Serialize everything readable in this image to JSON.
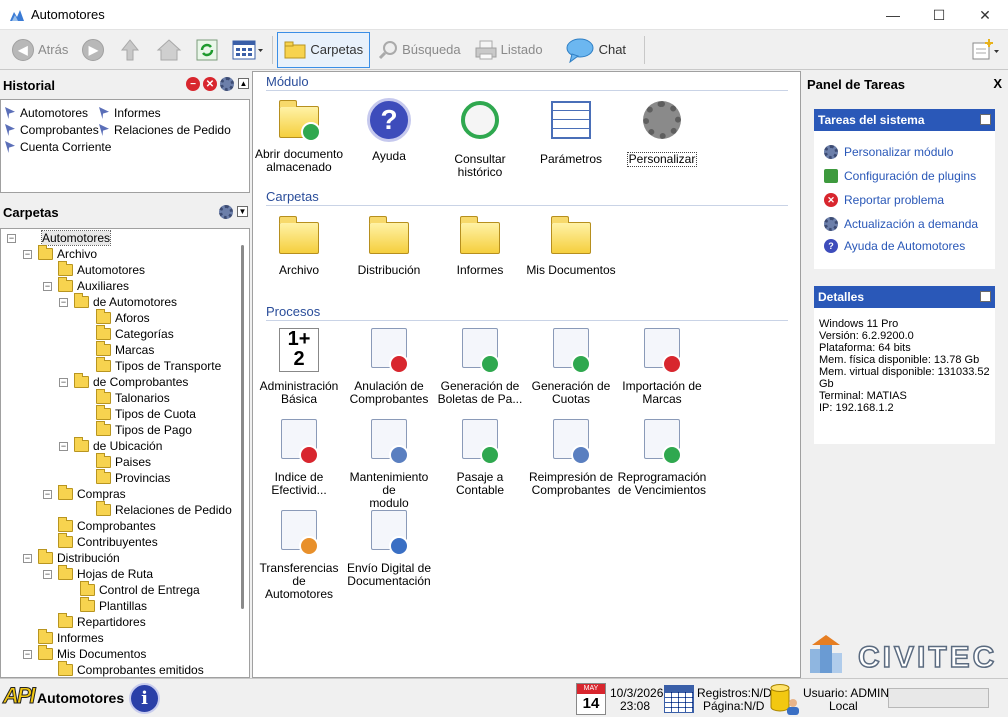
{
  "window": {
    "title": "Automotores",
    "minimize": "—",
    "maximize": "☐",
    "close": "✕"
  },
  "toolbar": {
    "back": "Atrás",
    "folders": "Carpetas",
    "search": "Búsqueda",
    "listing": "Listado",
    "chat": "Chat"
  },
  "history": {
    "title": "Historial",
    "items": [
      "Automotores",
      "Informes",
      "Comprobantes",
      "Relaciones de Pedido",
      "Cuenta Corriente"
    ]
  },
  "folders_tree": {
    "title": "Carpetas",
    "rows": [
      {
        "label": "Automotores",
        "expander": "−"
      },
      {
        "label": "Archivo",
        "expander": "−"
      },
      {
        "label": "Automotores",
        "expander": ""
      },
      {
        "label": "Auxiliares",
        "expander": "−"
      },
      {
        "label": "de Automotores",
        "expander": "−"
      },
      {
        "label": "Aforos",
        "expander": ""
      },
      {
        "label": "Categorías",
        "expander": ""
      },
      {
        "label": "Marcas",
        "expander": ""
      },
      {
        "label": "Tipos de Transporte",
        "expander": ""
      },
      {
        "label": "de Comprobantes",
        "expander": "−"
      },
      {
        "label": "Talonarios",
        "expander": ""
      },
      {
        "label": "Tipos de Cuota",
        "expander": ""
      },
      {
        "label": "Tipos de Pago",
        "expander": ""
      },
      {
        "label": "de Ubicación",
        "expander": "−"
      },
      {
        "label": "Paises",
        "expander": ""
      },
      {
        "label": "Provincias",
        "expander": ""
      },
      {
        "label": "Compras",
        "expander": "−"
      },
      {
        "label": "Relaciones de Pedido",
        "expander": ""
      },
      {
        "label": "Comprobantes",
        "expander": ""
      },
      {
        "label": "Contribuyentes",
        "expander": ""
      },
      {
        "label": "Distribución",
        "expander": "−"
      },
      {
        "label": "Hojas de Ruta",
        "expander": "−"
      },
      {
        "label": "Control de Entrega",
        "expander": ""
      },
      {
        "label": "Plantillas",
        "expander": ""
      },
      {
        "label": "Repartidores",
        "expander": ""
      },
      {
        "label": "Informes",
        "expander": ""
      },
      {
        "label": "Mis Documentos",
        "expander": "−"
      },
      {
        "label": "Comprobantes emitidos",
        "expander": ""
      }
    ]
  },
  "main": {
    "sections": {
      "module": "Módulo",
      "folders": "Carpetas",
      "processes": "Procesos"
    },
    "module_items": [
      {
        "l1": "Abrir documento",
        "l2": "almacenado"
      },
      {
        "l1": "Ayuda",
        "l2": ""
      },
      {
        "l1": "Consultar",
        "l2": "histórico"
      },
      {
        "l1": "Parámetros",
        "l2": ""
      },
      {
        "l1": "Personalizar",
        "l2": ""
      }
    ],
    "folder_items": [
      "Archivo",
      "Distribución",
      "Informes",
      "Mis Documentos"
    ],
    "process_items": [
      {
        "l1": "Administración",
        "l2": "Básica"
      },
      {
        "l1": "Anulación de",
        "l2": "Comprobantes"
      },
      {
        "l1": "Generación de",
        "l2": "Boletas de Pa..."
      },
      {
        "l1": "Generación de",
        "l2": "Cuotas"
      },
      {
        "l1": "Importación de",
        "l2": "Marcas"
      },
      {
        "l1": "Indice de",
        "l2": "Efectivid..."
      },
      {
        "l1": "Mantenimiento de",
        "l2": "modulo"
      },
      {
        "l1": "Pasaje a Contable",
        "l2": ""
      },
      {
        "l1": "Reimpresión de",
        "l2": "Comprobantes"
      },
      {
        "l1": "Reprogramación",
        "l2": "de Vencimientos"
      },
      {
        "l1": "Transferencias de",
        "l2": "Automotores"
      },
      {
        "l1": "Envío Digital de",
        "l2": "Documentación"
      }
    ]
  },
  "task_panel": {
    "title": "Panel de Tareas",
    "close": "X",
    "system_tasks_title": "Tareas del sistema",
    "tasks": [
      "Personalizar módulo",
      "Configuración de plugins",
      "Reportar problema",
      "Actualización a demanda",
      "Ayuda de Automotores"
    ],
    "details_title": "Detalles",
    "details": [
      "Windows 11 Pro",
      "Versión: 6.2.9200.0",
      "Plataforma: 64 bits",
      "Mem. física disponible: 13.78 Gb",
      "Mem. virtual disponible: 131033.52",
      "Gb",
      "Terminal: MATIAS",
      "IP: 192.168.1.2"
    ],
    "logo_text": "CIVITEC"
  },
  "statusbar": {
    "app_name": "Automotores",
    "logo_text": "API",
    "calendar_month": "MAY",
    "calendar_day": "14",
    "date": "10/3/2026",
    "time": "23:08",
    "records": "Registros:N/D",
    "page": "Página:N/D",
    "user": "Usuario: ADMIN",
    "location": "Local"
  }
}
